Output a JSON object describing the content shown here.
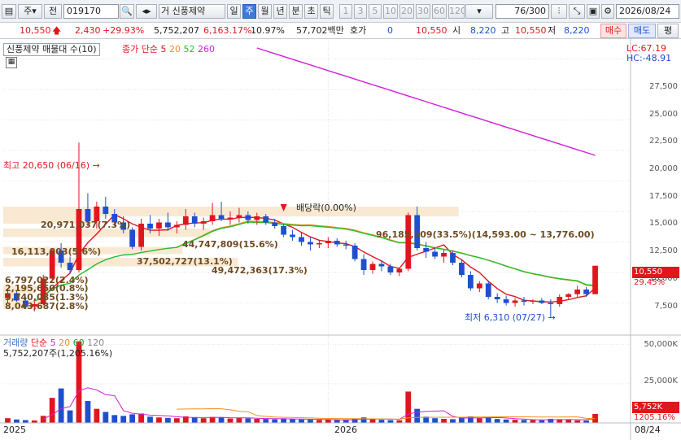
{
  "toolbar": {
    "market_type": "주",
    "prev_label": "전",
    "code": "019170",
    "stock_prefix": "거",
    "stock_name": "신풍제약",
    "periods": [
      "일",
      "주",
      "월",
      "년",
      "분",
      "초",
      "틱"
    ],
    "selected_period": "주",
    "intervals": [
      "1",
      "3",
      "5",
      "10",
      "20",
      "30",
      "60",
      "120"
    ],
    "count": "76",
    "count_total": "/300",
    "date": "2026/08/24"
  },
  "quote": {
    "price": "10,550",
    "change": "2,430",
    "change_pct": "+29.93%",
    "volume": "5,752,207",
    "volume_pct": "6,163.17%",
    "turnover": "10.97%",
    "amount": "57,702백만",
    "bid_label": "호가",
    "bid_value": "0",
    "ask_price": "10,550",
    "open_label": "시",
    "open": "8,220",
    "high_label": "고",
    "high": "10,550",
    "low_label": "저",
    "low": "8,220",
    "buy_btn": "매수",
    "sell_btn": "매도",
    "extra_btn": "평"
  },
  "price_panel": {
    "legend_name": "신풍제약 매물대 수(10)",
    "ma_label": "종가 단순",
    "ma_periods": [
      "5",
      "20",
      "52",
      "260"
    ],
    "lc_label": "LC:67.19",
    "hc_label": "HC:-48.91",
    "high_annotation": "최고 20,650 (06/16)",
    "low_annotation": "최저 6,310 (07/27)",
    "dividend_annotation": "배당락(0.00%)",
    "current_price_tag": "10,550",
    "current_change_tag": "29.45%",
    "y_ticks": [
      "27,500",
      "25,000",
      "22,500",
      "20,000",
      "17,500",
      "15,000",
      "12,500",
      "10,000",
      "7,500"
    ],
    "volume_profile_labels": [
      "20,971,037(7.3%)",
      "16,113,803(5.6%)",
      "37,502,727(13.1%)",
      "44,747,809(15.6%)",
      "49,472,363(17.3%)",
      "96,185,509(33.5%)(14,593.00 ~ 13,776.00)",
      "6,797,022(2.4%)",
      "2,195,650(0.8%)",
      "3,740,085(1.3%)",
      "8,043,687(2.8%)"
    ]
  },
  "volume_panel": {
    "legend_name": "거래량",
    "ma_label": "단순",
    "ma_periods": [
      "5",
      "20",
      "60",
      "120"
    ],
    "value_label": "5,752,207주(1,205.16%)",
    "y_ticks": [
      "50,000K",
      "25,000K"
    ],
    "current_volume_tag": "5,752K",
    "current_pct_tag": "1205.16%"
  },
  "x_axis": {
    "labels": [
      "2025",
      "2026"
    ],
    "last_date": "08/24"
  },
  "colors": {
    "up": "#e0161e",
    "down": "#1f4fcf",
    "ma5": "#e0161e",
    "ma20": "#f0901a",
    "ma52": "#22c02a",
    "ma260": "#d21fd6"
  },
  "chart_data": {
    "type": "candlestick",
    "price_range": [
      5000,
      29000
    ],
    "volume_range": [
      0,
      55000
    ],
    "candles": [
      [
        7900,
        8600,
        7500,
        8300
      ],
      [
        8300,
        8500,
        7600,
        7700
      ],
      [
        7700,
        8000,
        7000,
        7200
      ],
      [
        7200,
        7600,
        6800,
        7400
      ],
      [
        7400,
        9800,
        7300,
        9500
      ],
      [
        9500,
        12000,
        9300,
        11800
      ],
      [
        11800,
        12400,
        10400,
        10800
      ],
      [
        10800,
        11300,
        9900,
        10200
      ],
      [
        10200,
        20650,
        10000,
        15200
      ],
      [
        15200,
        16500,
        13800,
        14200
      ],
      [
        14200,
        15800,
        13600,
        15400
      ],
      [
        15400,
        16200,
        14400,
        14800
      ],
      [
        14800,
        15200,
        13800,
        14100
      ],
      [
        14100,
        14600,
        13200,
        13500
      ],
      [
        13500,
        13700,
        11900,
        12100
      ],
      [
        12100,
        14400,
        11800,
        14000
      ],
      [
        14000,
        14700,
        13200,
        13600
      ],
      [
        13600,
        14400,
        13000,
        14100
      ],
      [
        14100,
        14900,
        13400,
        13700
      ],
      [
        13700,
        14200,
        13200,
        13900
      ],
      [
        13900,
        15200,
        13500,
        14600
      ],
      [
        14600,
        14900,
        13700,
        14000
      ],
      [
        14000,
        14500,
        13500,
        14200
      ],
      [
        14200,
        15700,
        13900,
        14700
      ],
      [
        14700,
        15800,
        14200,
        14400
      ],
      [
        14400,
        15000,
        13900,
        14500
      ],
      [
        14500,
        15300,
        14100,
        14700
      ],
      [
        14700,
        15000,
        14000,
        14300
      ],
      [
        14300,
        14900,
        13900,
        14600
      ],
      [
        14600,
        14800,
        13900,
        14100
      ],
      [
        14100,
        14400,
        13600,
        13800
      ],
      [
        13800,
        14000,
        12900,
        13100
      ],
      [
        13100,
        13500,
        12600,
        12900
      ],
      [
        12900,
        13300,
        12200,
        12500
      ],
      [
        12500,
        12900,
        11800,
        12300
      ],
      [
        12300,
        12600,
        12000,
        12400
      ],
      [
        12400,
        12900,
        12000,
        12600
      ],
      [
        12600,
        12800,
        12100,
        12300
      ],
      [
        12300,
        12600,
        11900,
        12200
      ],
      [
        12200,
        12400,
        10900,
        11100
      ],
      [
        11100,
        11500,
        9800,
        10200
      ],
      [
        10200,
        10900,
        9900,
        10700
      ],
      [
        10700,
        11000,
        10100,
        10500
      ],
      [
        10500,
        10700,
        9800,
        10000
      ],
      [
        10000,
        10400,
        9700,
        10300
      ],
      [
        10300,
        14900,
        10100,
        14700
      ],
      [
        14700,
        15400,
        11800,
        12000
      ],
      [
        12000,
        12500,
        11200,
        11700
      ],
      [
        11700,
        12100,
        11100,
        11300
      ],
      [
        11300,
        11900,
        10800,
        11600
      ],
      [
        11600,
        11800,
        10600,
        10800
      ],
      [
        10800,
        11000,
        9600,
        9800
      ],
      [
        9800,
        10100,
        8500,
        8700
      ],
      [
        8700,
        9300,
        8400,
        9100
      ],
      [
        9100,
        9300,
        7800,
        8000
      ],
      [
        8000,
        8300,
        7500,
        7800
      ],
      [
        7800,
        8100,
        7300,
        7500
      ],
      [
        7500,
        7900,
        7200,
        7700
      ],
      [
        7700,
        8000,
        7300,
        7600
      ],
      [
        7600,
        7800,
        7400,
        7700
      ],
      [
        7700,
        7900,
        7400,
        7500
      ],
      [
        7500,
        7800,
        6310,
        7400
      ],
      [
        7400,
        8200,
        7200,
        8000
      ],
      [
        8000,
        8300,
        7800,
        8220
      ],
      [
        8220,
        8900,
        8000,
        8600
      ],
      [
        8600,
        8800,
        8000,
        8220
      ],
      [
        8220,
        10550,
        8220,
        10550
      ]
    ],
    "volumes": [
      3000,
      2200,
      1800,
      1600,
      4500,
      16000,
      22000,
      8000,
      52000,
      14000,
      9000,
      7000,
      5000,
      4500,
      5500,
      6000,
      4000,
      3500,
      3200,
      3000,
      4200,
      3600,
      3000,
      3800,
      3400,
      2800,
      3100,
      2900,
      2600,
      2500,
      2300,
      2900,
      2400,
      2200,
      2000,
      1900,
      2100,
      1800,
      2000,
      2600,
      3500,
      2400,
      2000,
      1800,
      1700,
      20000,
      9000,
      4000,
      3000,
      2600,
      2400,
      3500,
      4200,
      3000,
      3800,
      2500,
      2200,
      2000,
      1900,
      1800,
      1700,
      2600,
      2400,
      2200,
      1600,
      1500,
      5752
    ]
  }
}
